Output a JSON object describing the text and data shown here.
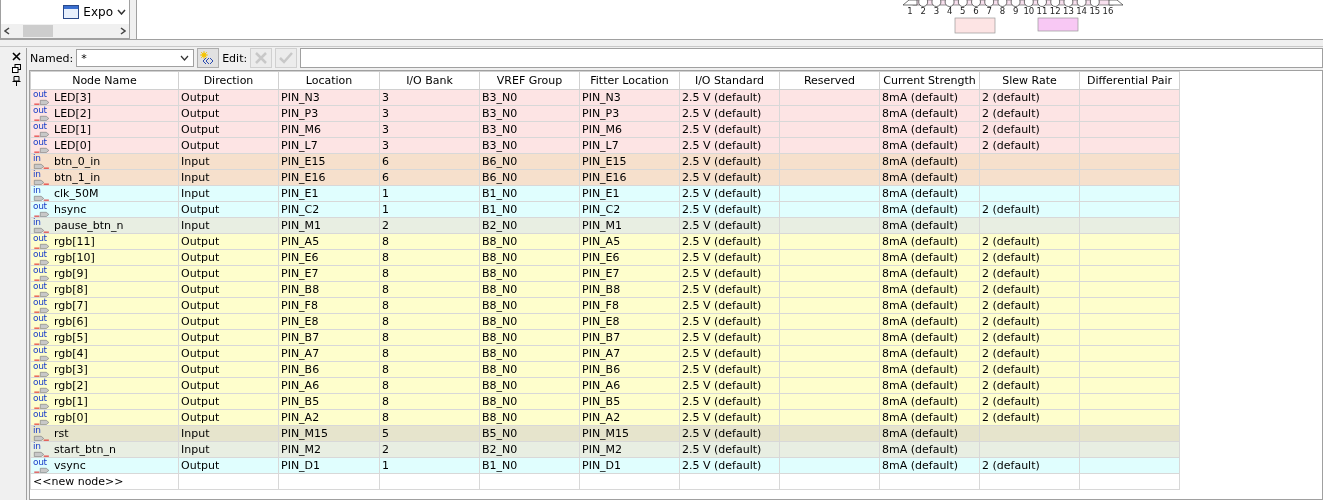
{
  "explorer": {
    "item_label": "Expo"
  },
  "diagram": {
    "pin_numbers": [
      "1",
      "2",
      "3",
      "4",
      "5",
      "6",
      "7",
      "8",
      "9",
      "10",
      "11",
      "12",
      "13",
      "14",
      "15",
      "16"
    ]
  },
  "toolbar": {
    "named_label": "Named:",
    "named_value": "*",
    "edit_label": "Edit:",
    "edit_buttons": [
      {
        "kind": "delete",
        "disabled": true
      },
      {
        "kind": "accept",
        "disabled": true
      }
    ]
  },
  "table": {
    "columns": [
      "Node Name",
      "Direction",
      "Location",
      "I/O Bank",
      "VREF Group",
      "Fitter Location",
      "I/O Standard",
      "Reserved",
      "Current Strength",
      "Slew Rate",
      "Differential Pair"
    ],
    "rows": [
      {
        "kind": "output",
        "port_label": "out",
        "node_name": "LED[3]",
        "direction": "Output",
        "location": "PIN_N3",
        "io_bank": "3",
        "vref_group": "B3_N0",
        "fitter_location": "PIN_N3",
        "io_standard": "2.5 V (default)",
        "current_strength": "8mA (default)",
        "slew_rate": "2 (default)",
        "color": "#fde4e4"
      },
      {
        "kind": "output",
        "port_label": "out",
        "node_name": "LED[2]",
        "direction": "Output",
        "location": "PIN_P3",
        "io_bank": "3",
        "vref_group": "B3_N0",
        "fitter_location": "PIN_P3",
        "io_standard": "2.5 V (default)",
        "current_strength": "8mA (default)",
        "slew_rate": "2 (default)",
        "color": "#fde4e4"
      },
      {
        "kind": "output",
        "port_label": "out",
        "node_name": "LED[1]",
        "direction": "Output",
        "location": "PIN_M6",
        "io_bank": "3",
        "vref_group": "B3_N0",
        "fitter_location": "PIN_M6",
        "io_standard": "2.5 V (default)",
        "current_strength": "8mA (default)",
        "slew_rate": "2 (default)",
        "color": "#fde4e4"
      },
      {
        "kind": "output",
        "port_label": "out",
        "node_name": "LED[0]",
        "direction": "Output",
        "location": "PIN_L7",
        "io_bank": "3",
        "vref_group": "B3_N0",
        "fitter_location": "PIN_L7",
        "io_standard": "2.5 V (default)",
        "current_strength": "8mA (default)",
        "slew_rate": "2 (default)",
        "color": "#fde4e4"
      },
      {
        "kind": "input",
        "port_label": "in",
        "node_name": "btn_0_in",
        "direction": "Input",
        "location": "PIN_E15",
        "io_bank": "6",
        "vref_group": "B6_N0",
        "fitter_location": "PIN_E15",
        "io_standard": "2.5 V (default)",
        "current_strength": "8mA (default)",
        "color": "#f6e0cc"
      },
      {
        "kind": "input",
        "port_label": "in",
        "node_name": "btn_1_in",
        "direction": "Input",
        "location": "PIN_E16",
        "io_bank": "6",
        "vref_group": "B6_N0",
        "fitter_location": "PIN_E16",
        "io_standard": "2.5 V (default)",
        "current_strength": "8mA (default)",
        "color": "#f6e0cc"
      },
      {
        "kind": "input",
        "port_label": "in",
        "node_name": "clk_50M",
        "direction": "Input",
        "location": "PIN_E1",
        "io_bank": "1",
        "vref_group": "B1_N0",
        "fitter_location": "PIN_E1",
        "io_standard": "2.5 V (default)",
        "current_strength": "8mA (default)",
        "color": "#e0fefe"
      },
      {
        "kind": "output",
        "port_label": "out",
        "node_name": "hsync",
        "direction": "Output",
        "location": "PIN_C2",
        "io_bank": "1",
        "vref_group": "B1_N0",
        "fitter_location": "PIN_C2",
        "io_standard": "2.5 V (default)",
        "current_strength": "8mA (default)",
        "slew_rate": "2 (default)",
        "color": "#e0fefe"
      },
      {
        "kind": "input",
        "port_label": "in",
        "node_name": "pause_btn_n",
        "direction": "Input",
        "location": "PIN_M1",
        "io_bank": "2",
        "vref_group": "B2_N0",
        "fitter_location": "PIN_M1",
        "io_standard": "2.5 V (default)",
        "current_strength": "8mA (default)",
        "color": "#e8eee2"
      },
      {
        "kind": "output",
        "port_label": "out",
        "node_name": "rgb[11]",
        "direction": "Output",
        "location": "PIN_A5",
        "io_bank": "8",
        "vref_group": "B8_N0",
        "fitter_location": "PIN_A5",
        "io_standard": "2.5 V (default)",
        "current_strength": "8mA (default)",
        "slew_rate": "2 (default)",
        "color": "#fefecc"
      },
      {
        "kind": "output",
        "port_label": "out",
        "node_name": "rgb[10]",
        "direction": "Output",
        "location": "PIN_E6",
        "io_bank": "8",
        "vref_group": "B8_N0",
        "fitter_location": "PIN_E6",
        "io_standard": "2.5 V (default)",
        "current_strength": "8mA (default)",
        "slew_rate": "2 (default)",
        "color": "#fefecc"
      },
      {
        "kind": "output",
        "port_label": "out",
        "node_name": "rgb[9]",
        "direction": "Output",
        "location": "PIN_E7",
        "io_bank": "8",
        "vref_group": "B8_N0",
        "fitter_location": "PIN_E7",
        "io_standard": "2.5 V (default)",
        "current_strength": "8mA (default)",
        "slew_rate": "2 (default)",
        "color": "#fefecc"
      },
      {
        "kind": "output",
        "port_label": "out",
        "node_name": "rgb[8]",
        "direction": "Output",
        "location": "PIN_B8",
        "io_bank": "8",
        "vref_group": "B8_N0",
        "fitter_location": "PIN_B8",
        "io_standard": "2.5 V (default)",
        "current_strength": "8mA (default)",
        "slew_rate": "2 (default)",
        "color": "#fefecc"
      },
      {
        "kind": "output",
        "port_label": "out",
        "node_name": "rgb[7]",
        "direction": "Output",
        "location": "PIN_F8",
        "io_bank": "8",
        "vref_group": "B8_N0",
        "fitter_location": "PIN_F8",
        "io_standard": "2.5 V (default)",
        "current_strength": "8mA (default)",
        "slew_rate": "2 (default)",
        "color": "#fefecc"
      },
      {
        "kind": "output",
        "port_label": "out",
        "node_name": "rgb[6]",
        "direction": "Output",
        "location": "PIN_E8",
        "io_bank": "8",
        "vref_group": "B8_N0",
        "fitter_location": "PIN_E8",
        "io_standard": "2.5 V (default)",
        "current_strength": "8mA (default)",
        "slew_rate": "2 (default)",
        "color": "#fefecc"
      },
      {
        "kind": "output",
        "port_label": "out",
        "node_name": "rgb[5]",
        "direction": "Output",
        "location": "PIN_B7",
        "io_bank": "8",
        "vref_group": "B8_N0",
        "fitter_location": "PIN_B7",
        "io_standard": "2.5 V (default)",
        "current_strength": "8mA (default)",
        "slew_rate": "2 (default)",
        "color": "#fefecc"
      },
      {
        "kind": "output",
        "port_label": "out",
        "node_name": "rgb[4]",
        "direction": "Output",
        "location": "PIN_A7",
        "io_bank": "8",
        "vref_group": "B8_N0",
        "fitter_location": "PIN_A7",
        "io_standard": "2.5 V (default)",
        "current_strength": "8mA (default)",
        "slew_rate": "2 (default)",
        "color": "#fefecc"
      },
      {
        "kind": "output",
        "port_label": "out",
        "node_name": "rgb[3]",
        "direction": "Output",
        "location": "PIN_B6",
        "io_bank": "8",
        "vref_group": "B8_N0",
        "fitter_location": "PIN_B6",
        "io_standard": "2.5 V (default)",
        "current_strength": "8mA (default)",
        "slew_rate": "2 (default)",
        "color": "#fefecc"
      },
      {
        "kind": "output",
        "port_label": "out",
        "node_name": "rgb[2]",
        "direction": "Output",
        "location": "PIN_A6",
        "io_bank": "8",
        "vref_group": "B8_N0",
        "fitter_location": "PIN_A6",
        "io_standard": "2.5 V (default)",
        "current_strength": "8mA (default)",
        "slew_rate": "2 (default)",
        "color": "#fefecc"
      },
      {
        "kind": "output",
        "port_label": "out",
        "node_name": "rgb[1]",
        "direction": "Output",
        "location": "PIN_B5",
        "io_bank": "8",
        "vref_group": "B8_N0",
        "fitter_location": "PIN_B5",
        "io_standard": "2.5 V (default)",
        "current_strength": "8mA (default)",
        "slew_rate": "2 (default)",
        "color": "#fefecc"
      },
      {
        "kind": "output",
        "port_label": "out",
        "node_name": "rgb[0]",
        "direction": "Output",
        "location": "PIN_A2",
        "io_bank": "8",
        "vref_group": "B8_N0",
        "fitter_location": "PIN_A2",
        "io_standard": "2.5 V (default)",
        "current_strength": "8mA (default)",
        "slew_rate": "2 (default)",
        "color": "#fefecc"
      },
      {
        "kind": "input",
        "port_label": "in",
        "node_name": "rst",
        "direction": "Input",
        "location": "PIN_M15",
        "io_bank": "5",
        "vref_group": "B5_N0",
        "fitter_location": "PIN_M15",
        "io_standard": "2.5 V (default)",
        "current_strength": "8mA (default)",
        "color": "#e6e4cc"
      },
      {
        "kind": "input",
        "port_label": "in",
        "node_name": "start_btn_n",
        "direction": "Input",
        "location": "PIN_M2",
        "io_bank": "2",
        "vref_group": "B2_N0",
        "fitter_location": "PIN_M2",
        "io_standard": "2.5 V (default)",
        "current_strength": "8mA (default)",
        "color": "#e8eee2"
      },
      {
        "kind": "output",
        "port_label": "out",
        "node_name": "vsync",
        "direction": "Output",
        "location": "PIN_D1",
        "io_bank": "1",
        "vref_group": "B1_N0",
        "fitter_location": "PIN_D1",
        "io_standard": "2.5 V (default)",
        "current_strength": "8mA (default)",
        "slew_rate": "2 (default)",
        "color": "#e0fefe"
      }
    ],
    "new_node": "<<new node>>"
  }
}
